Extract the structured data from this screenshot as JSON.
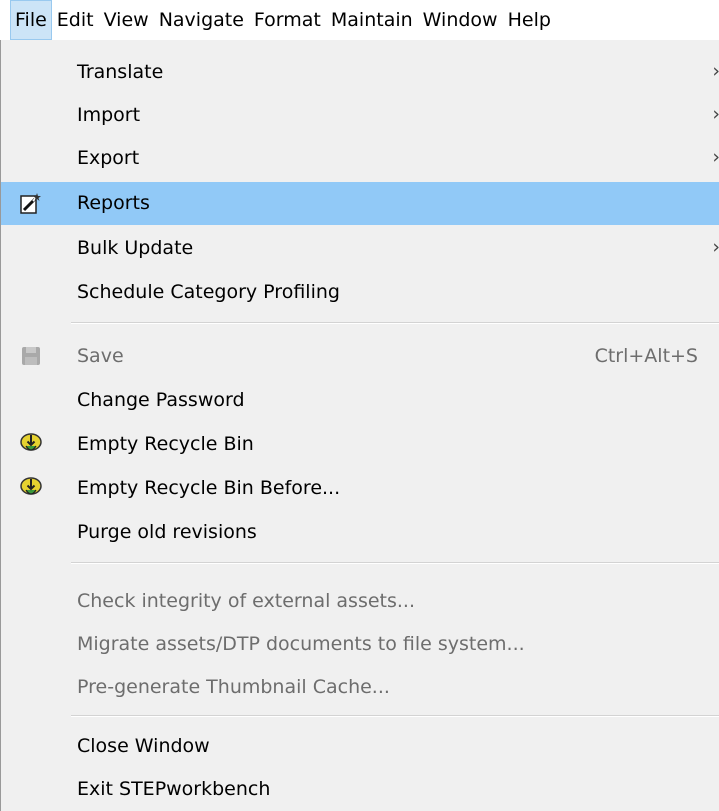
{
  "menubar": {
    "items": [
      "File",
      "Edit",
      "View",
      "Navigate",
      "Format",
      "Maintain",
      "Window",
      "Help"
    ]
  },
  "menu": {
    "translate": "Translate",
    "import": "Import",
    "export": "Export",
    "reports": "Reports",
    "bulk_update": "Bulk Update",
    "schedule_category_profiling": "Schedule Category Profiling",
    "save": "Save",
    "save_shortcut": "Ctrl+Alt+S",
    "change_password": "Change Password",
    "empty_recycle_bin": "Empty Recycle Bin",
    "empty_recycle_bin_before": "Empty Recycle Bin Before...",
    "purge_old_revisions": "Purge old revisions",
    "check_integrity": "Check integrity of external assets...",
    "migrate_assets": "Migrate assets/DTP documents to file system...",
    "pregenerate_thumbnail": "Pre-generate Thumbnail Cache...",
    "close_window": "Close Window",
    "exit": "Exit STEPworkbench",
    "submenu_arrow": "›"
  },
  "colors": {
    "highlight": "#91c9f7",
    "open_menu": "#cce4f7",
    "disabled_text": "#6d6d6d"
  },
  "icons": {
    "reports": "report-wizard-icon",
    "save": "floppy-disk-icon",
    "empty_recycle_bin": "recycle-bin-icon",
    "empty_recycle_bin_before": "recycle-bin-icon"
  }
}
